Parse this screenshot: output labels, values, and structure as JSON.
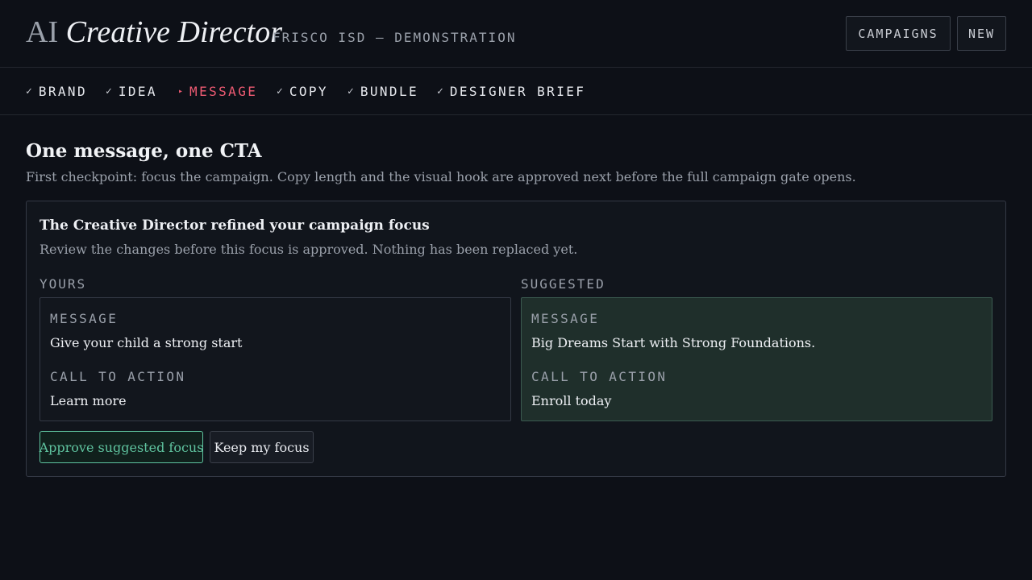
{
  "header": {
    "brand_prefix": "AI",
    "brand_name": "Creative Director",
    "subtitle": "FRISCO ISD — DEMONSTRATION",
    "campaigns_label": "CAMPAIGNS",
    "new_label": "NEW"
  },
  "steps": [
    {
      "mark": "✓",
      "label": "BRAND",
      "state": "done"
    },
    {
      "mark": "✓",
      "label": "IDEA",
      "state": "done"
    },
    {
      "mark": "▸",
      "label": "MESSAGE",
      "state": "active"
    },
    {
      "mark": "✓",
      "label": "COPY",
      "state": "done"
    },
    {
      "mark": "✓",
      "label": "BUNDLE",
      "state": "done"
    },
    {
      "mark": "✓",
      "label": "DESIGNER BRIEF",
      "state": "done"
    }
  ],
  "page": {
    "title": "One message, one CTA",
    "description": "First checkpoint: focus the campaign. Copy length and the visual hook are approved next before the full campaign gate opens."
  },
  "review": {
    "title": "The Creative Director refined your campaign focus",
    "description": "Review the changes before this focus is approved. Nothing has been replaced yet.",
    "yours": {
      "label": "YOURS",
      "message_label": "MESSAGE",
      "message": "Give your child a strong start",
      "cta_label": "CALL TO ACTION",
      "cta": "Learn more"
    },
    "suggested": {
      "label": "SUGGESTED",
      "message_label": "MESSAGE",
      "message": "Big Dreams Start with Strong Foundations.",
      "cta_label": "CALL TO ACTION",
      "cta": "Enroll today"
    },
    "approve_label": "Approve suggested focus",
    "keep_label": "Keep my focus"
  },
  "colors": {
    "background": "#0d1017",
    "active_step": "#ef5b73",
    "approve_accent": "#5fc39f",
    "suggested_bg": "#1f2f2b"
  }
}
